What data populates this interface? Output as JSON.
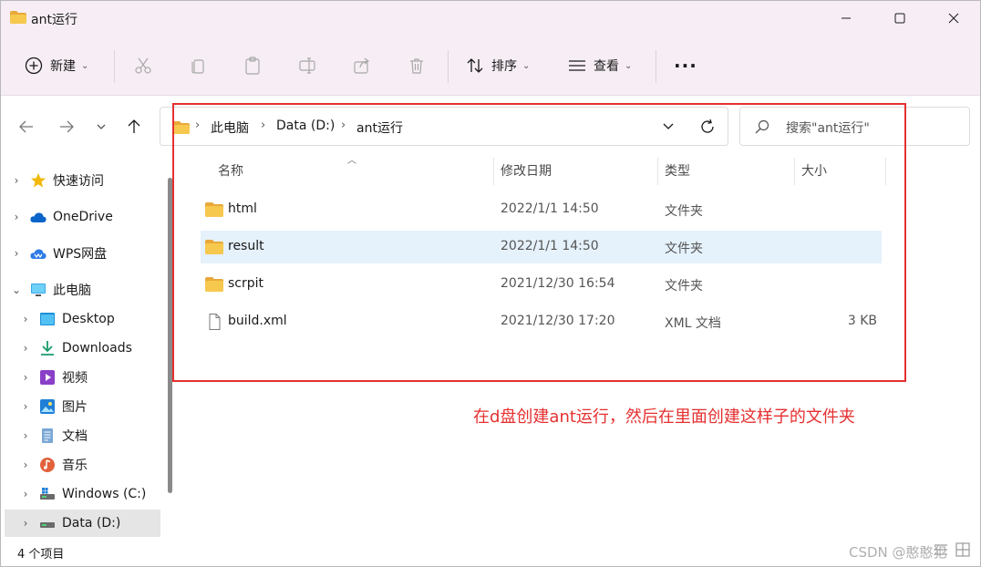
{
  "window": {
    "title": "ant运行"
  },
  "toolbar": {
    "new_label": "新建",
    "sort_label": "排序",
    "view_label": "查看",
    "more_label": "···"
  },
  "address": {
    "crumbs": [
      "此电脑",
      "Data (D:)",
      "ant运行"
    ]
  },
  "search": {
    "placeholder": "搜索\"ant运行\""
  },
  "sidebar": {
    "items": [
      {
        "label": "快速访问",
        "icon": "star-icon"
      },
      {
        "label": "OneDrive",
        "icon": "cloud-icon"
      },
      {
        "label": "WPS网盘",
        "icon": "wps-cloud-icon"
      },
      {
        "label": "此电脑",
        "icon": "computer-icon"
      },
      {
        "label": "Desktop",
        "icon": "desktop-icon"
      },
      {
        "label": "Downloads",
        "icon": "download-icon"
      },
      {
        "label": "视频",
        "icon": "video-icon"
      },
      {
        "label": "图片",
        "icon": "picture-icon"
      },
      {
        "label": "文档",
        "icon": "document-icon"
      },
      {
        "label": "音乐",
        "icon": "music-icon"
      },
      {
        "label": "Windows (C:)",
        "icon": "drive-icon"
      },
      {
        "label": "Data (D:)",
        "icon": "drive-icon"
      }
    ]
  },
  "columns": [
    "名称",
    "修改日期",
    "类型",
    "大小"
  ],
  "files": [
    {
      "name": "html",
      "date": "2022/1/1 14:50",
      "type": "文件夹",
      "size": "",
      "icon": "folder-icon"
    },
    {
      "name": "result",
      "date": "2022/1/1 14:50",
      "type": "文件夹",
      "size": "",
      "icon": "folder-icon"
    },
    {
      "name": "scrpit",
      "date": "2021/12/30 16:54",
      "type": "文件夹",
      "size": "",
      "icon": "folder-icon"
    },
    {
      "name": "build.xml",
      "date": "2021/12/30 17:20",
      "type": "XML 文档",
      "size": "3 KB",
      "icon": "file-icon"
    }
  ],
  "annotation": "在d盘创建ant运行，然后在里面创建这样子的文件夹",
  "status": "4 个项目",
  "watermark": "CSDN @憨憨犯",
  "colors": {
    "accent": "#0067c0",
    "annotation": "#e53030",
    "folder": "#f4c04a"
  }
}
